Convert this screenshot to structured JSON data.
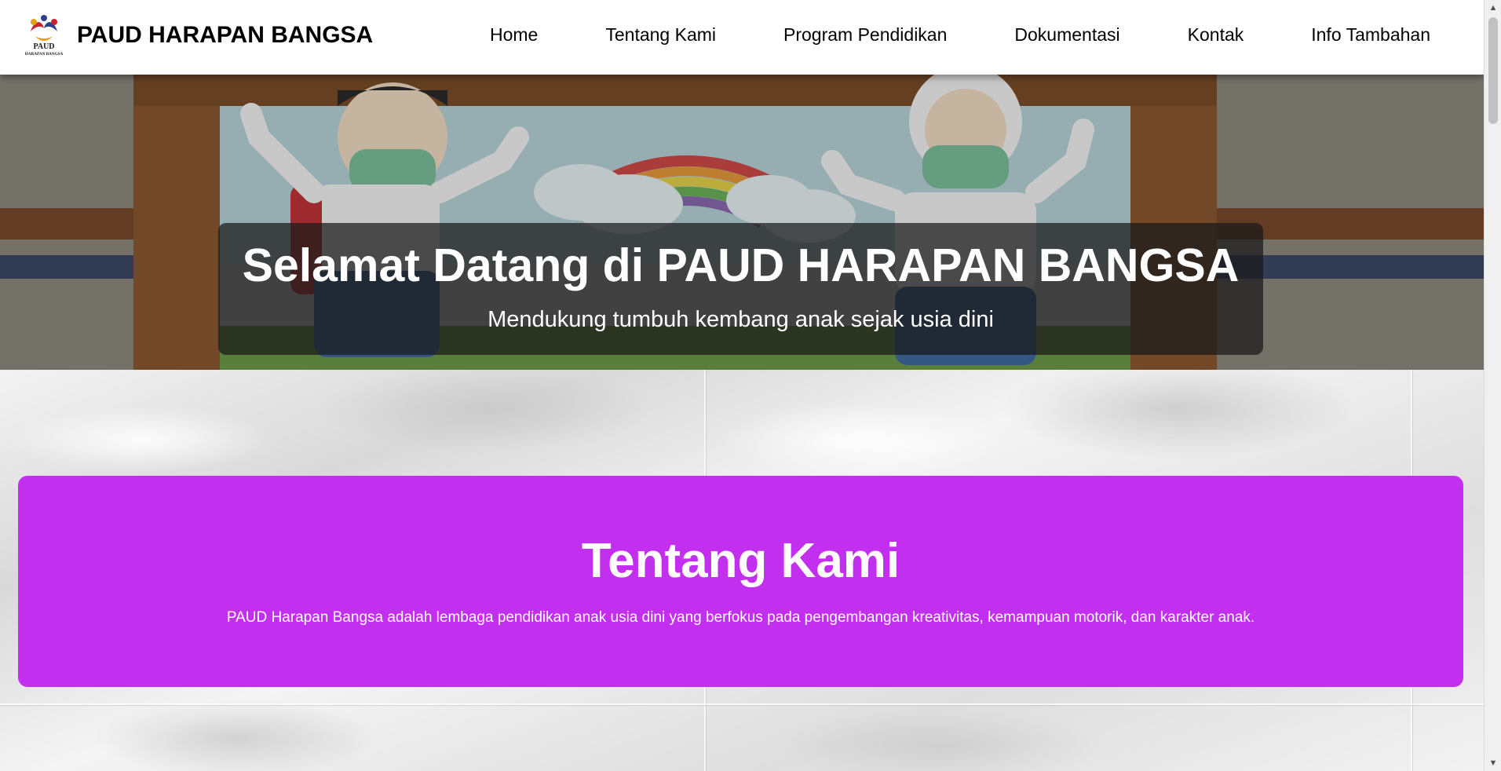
{
  "navbar": {
    "brand": "PAUD HARAPAN BANGSA",
    "logo_text_main": "PAUD",
    "logo_text_sub": "HARAPAN BANGSA",
    "links": [
      {
        "label": "Home"
      },
      {
        "label": "Tentang Kami"
      },
      {
        "label": "Program Pendidikan"
      },
      {
        "label": "Dokumentasi"
      },
      {
        "label": "Kontak"
      },
      {
        "label": "Info Tambahan"
      }
    ]
  },
  "hero": {
    "title": "Selamat Datang di PAUD HARAPAN BANGSA",
    "subtitle": "Mendukung tumbuh kembang anak sejak usia dini"
  },
  "about": {
    "title": "Tentang Kami",
    "text": "PAUD Harapan Bangsa adalah lembaga pendidikan anak usia dini yang berfokus pada pengembangan kreativitas, kemampuan motorik, dan karakter anak."
  },
  "colors": {
    "about_background": "#c22fee",
    "navbar_background": "#ffffff",
    "hero_box_background": "rgba(25,25,25,0.72)"
  },
  "icons": {
    "logo": "paud-logo-icon",
    "scroll_up": "scroll-up-arrow-icon",
    "scroll_down": "scroll-down-arrow-icon"
  }
}
